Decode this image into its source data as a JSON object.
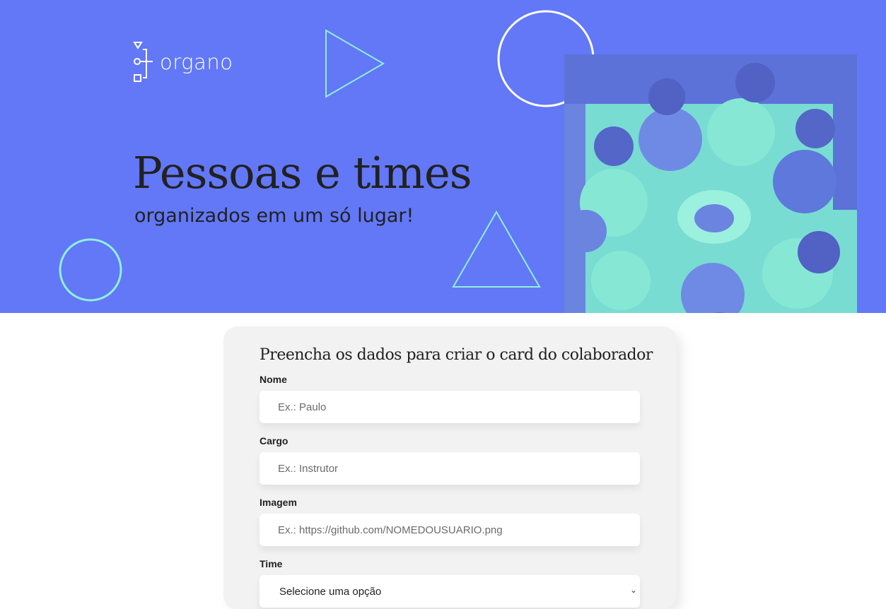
{
  "brand": {
    "name": "organo"
  },
  "hero": {
    "title": "Pessoas e times",
    "subtitle": "organizados em um só lugar!"
  },
  "colors": {
    "banner": "#6278f7",
    "accent": "#8ff0dc",
    "card_background": "#f2f2f2"
  },
  "form": {
    "heading": "Preencha os dados para criar o card do colaborador",
    "fields": [
      {
        "label": "Nome",
        "placeholder": "Ex.: Paulo"
      },
      {
        "label": "Cargo",
        "placeholder": "Ex.: Instrutor"
      },
      {
        "label": "Imagem",
        "placeholder": "Ex.: https://github.com/NOMEDOUSUARIO.png"
      }
    ],
    "select": {
      "label": "Time",
      "value": "Selecione uma opção",
      "icon": "chevron-down-icon"
    }
  }
}
